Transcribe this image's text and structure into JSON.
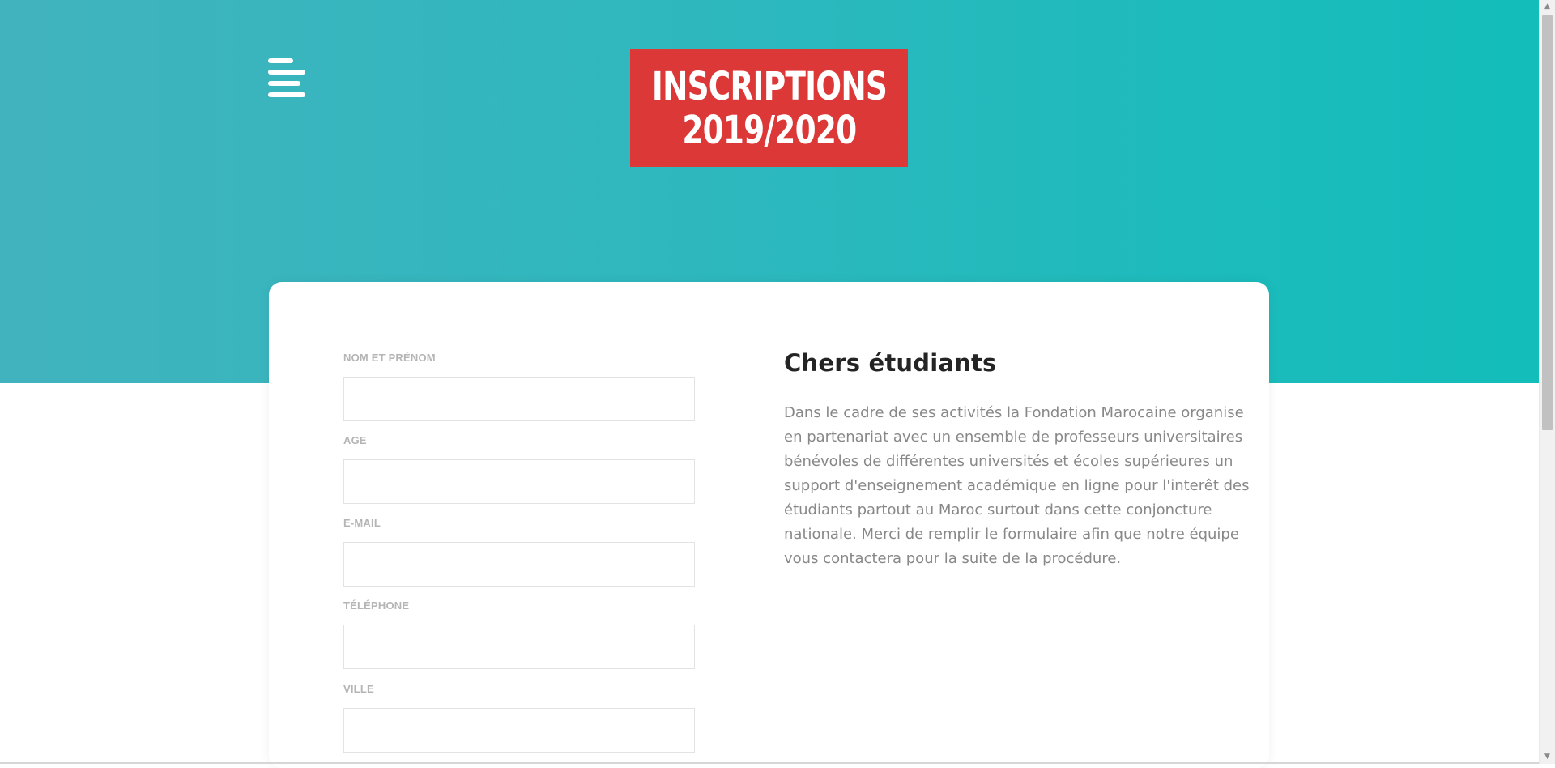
{
  "header": {
    "menu_icon": "hamburger-menu-icon",
    "logo": {
      "line1": "INSCRIPTIONS",
      "line2": "2019/2020"
    },
    "colors": {
      "gradient_start": "#41b3be",
      "gradient_end": "#12bdba",
      "badge": "#dd3838"
    }
  },
  "form": {
    "fields": [
      {
        "label": "NOM ET PRÉNOM",
        "value": "",
        "placeholder": ""
      },
      {
        "label": "AGE",
        "value": "",
        "placeholder": ""
      },
      {
        "label": "E-MAIL",
        "value": "",
        "placeholder": ""
      },
      {
        "label": "TÉLÉPHONE",
        "value": "",
        "placeholder": ""
      },
      {
        "label": "VILLE",
        "value": "",
        "placeholder": ""
      }
    ]
  },
  "intro": {
    "title": "Chers étudiants",
    "text": "Dans le cadre de ses activités la Fondation Marocaine organise en partenariat avec un ensemble de professeurs universitaires bénévoles de différentes universités et écoles supérieures un support d'enseignement académique en ligne pour l'interêt des étudiants partout au Maroc surtout dans cette conjoncture nationale. Merci de remplir le formulaire afin que notre équipe vous contactera pour la suite de la procédure."
  }
}
